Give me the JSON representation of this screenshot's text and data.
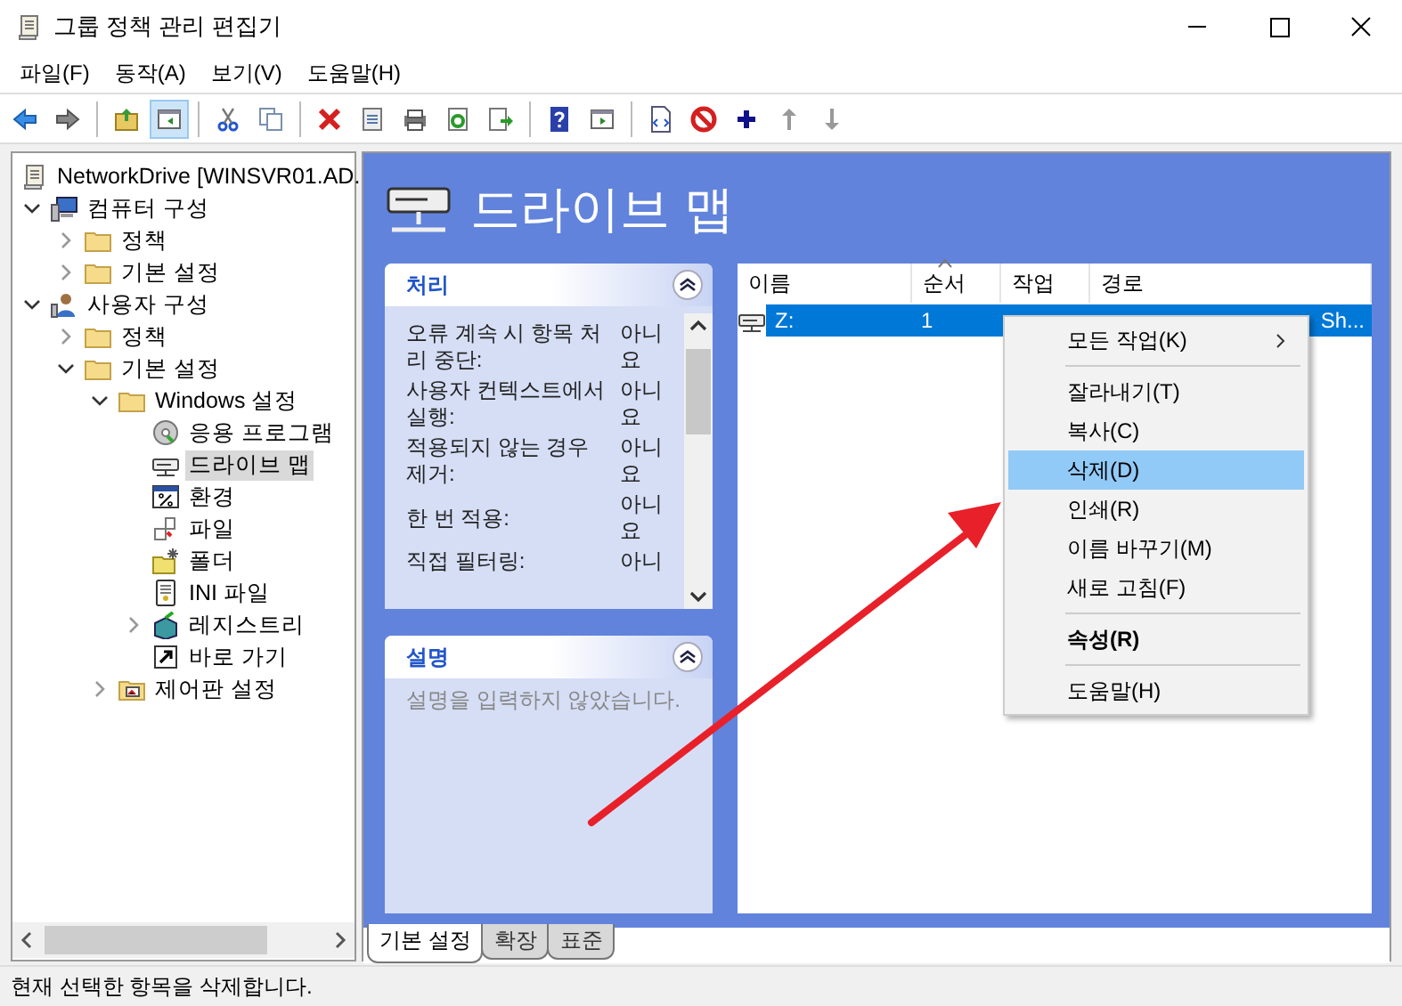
{
  "window": {
    "title": "그룹 정책 관리 편집기"
  },
  "menu": [
    "파일(F)",
    "동작(A)",
    "보기(V)",
    "도움말(H)"
  ],
  "toolbar": [
    {
      "kind": "back",
      "selected": false
    },
    {
      "kind": "forward",
      "selected": false
    },
    {
      "kind": "sep"
    },
    {
      "kind": "up",
      "selected": false
    },
    {
      "kind": "tree",
      "selected": true
    },
    {
      "kind": "sep"
    },
    {
      "kind": "cut",
      "selected": false
    },
    {
      "kind": "copy",
      "selected": false
    },
    {
      "kind": "sep"
    },
    {
      "kind": "delete",
      "selected": false
    },
    {
      "kind": "props",
      "selected": false
    },
    {
      "kind": "print",
      "selected": false
    },
    {
      "kind": "refresh",
      "selected": false
    },
    {
      "kind": "export",
      "selected": false
    },
    {
      "kind": "sep"
    },
    {
      "kind": "help",
      "selected": false
    },
    {
      "kind": "pane",
      "selected": false
    },
    {
      "kind": "sep"
    },
    {
      "kind": "script",
      "selected": false
    },
    {
      "kind": "stop",
      "selected": false
    },
    {
      "kind": "plus",
      "selected": false
    },
    {
      "kind": "moveup",
      "selected": false
    },
    {
      "kind": "movedown",
      "selected": false
    }
  ],
  "tree": [
    {
      "label": "NetworkDrive [WINSVR01.AD.",
      "kind": "policy",
      "selected": false,
      "children": [
        {
          "label": "컴퓨터 구성",
          "kind": "computer",
          "expanded": true,
          "selected": false,
          "children": [
            {
              "label": "정책",
              "kind": "folder",
              "expanded": false,
              "selected": false
            },
            {
              "label": "기본 설정",
              "kind": "folder",
              "expanded": false,
              "selected": false
            }
          ]
        },
        {
          "label": "사용자 구성",
          "kind": "user",
          "expanded": true,
          "selected": false,
          "children": [
            {
              "label": "정책",
              "kind": "folder",
              "expanded": false,
              "selected": false
            },
            {
              "label": "기본 설정",
              "kind": "folder",
              "expanded": true,
              "selected": false,
              "children": [
                {
                  "label": "Windows 설정",
                  "kind": "folder",
                  "expanded": true,
                  "selected": false,
                  "children": [
                    {
                      "label": "응용 프로그램",
                      "kind": "disc",
                      "selected": false
                    },
                    {
                      "label": "드라이브 맵",
                      "kind": "drive",
                      "selected": true
                    },
                    {
                      "label": "환경",
                      "kind": "env",
                      "selected": false
                    },
                    {
                      "label": "파일",
                      "kind": "file",
                      "selected": false
                    },
                    {
                      "label": "폴더",
                      "kind": "newfolder",
                      "selected": false
                    },
                    {
                      "label": "INI 파일",
                      "kind": "ini",
                      "selected": false
                    },
                    {
                      "label": "레지스트리",
                      "kind": "registry",
                      "expanded": false,
                      "selected": false
                    },
                    {
                      "label": "바로 가기",
                      "kind": "shortcut",
                      "selected": false
                    }
                  ]
                },
                {
                  "label": "제어판 설정",
                  "kind": "control",
                  "expanded": false,
                  "selected": false
                }
              ]
            }
          ]
        }
      ]
    }
  ],
  "details": {
    "heading": "드라이브 맵",
    "panels": [
      {
        "kind": "props",
        "title": "처리",
        "rows": [
          {
            "label": "오류 계속 시 항목 처리 중단:",
            "value": "아니요"
          },
          {
            "label": "사용자 컨텍스트에서 실행:",
            "value": "아니요"
          },
          {
            "label": "적용되지 않는 경우 제거:",
            "value": "아니요"
          },
          {
            "label": "한 번 적용:",
            "value": "아니요"
          },
          {
            "label": "직접 필터링:",
            "value": "아니"
          }
        ]
      },
      {
        "kind": "text",
        "title": "설명",
        "text": "설명을 입력하지 않았습니다."
      }
    ],
    "columns": [
      {
        "label": "이름",
        "sorted": false
      },
      {
        "label": "순서",
        "sorted": true
      },
      {
        "label": "작업",
        "sorted": false
      },
      {
        "label": "경로",
        "sorted": false
      }
    ],
    "rows": [
      {
        "name": "Z:",
        "order": "1",
        "path": "Sh...",
        "selected": true
      }
    ],
    "tabs": [
      {
        "label": "기본 설정",
        "selected": true
      },
      {
        "label": "확장",
        "selected": false
      },
      {
        "label": "표준",
        "selected": false
      }
    ]
  },
  "context_menu": [
    {
      "kind": "item",
      "label": "모든 작업(K)",
      "submenu": true,
      "default": false,
      "selected": false
    },
    {
      "kind": "separator"
    },
    {
      "kind": "item",
      "label": "잘라내기(T)",
      "submenu": false,
      "default": false,
      "selected": false
    },
    {
      "kind": "item",
      "label": "복사(C)",
      "submenu": false,
      "default": false,
      "selected": false
    },
    {
      "kind": "item",
      "label": "삭제(D)",
      "submenu": false,
      "default": false,
      "selected": true
    },
    {
      "kind": "item",
      "label": "인쇄(R)",
      "submenu": false,
      "default": false,
      "selected": false
    },
    {
      "kind": "item",
      "label": "이름 바꾸기(M)",
      "submenu": false,
      "default": false,
      "selected": false
    },
    {
      "kind": "item",
      "label": "새로 고침(F)",
      "submenu": false,
      "default": false,
      "selected": false
    },
    {
      "kind": "separator"
    },
    {
      "kind": "item",
      "label": "속성(R)",
      "submenu": false,
      "default": true,
      "selected": false
    },
    {
      "kind": "separator"
    },
    {
      "kind": "item",
      "label": "도움말(H)",
      "submenu": false,
      "default": false,
      "selected": false
    }
  ],
  "status_bar": "현재 선택한 항목을 삭제합니다."
}
